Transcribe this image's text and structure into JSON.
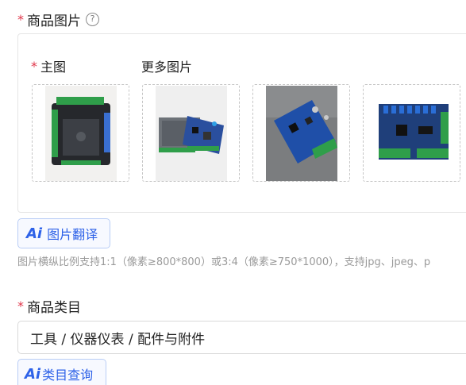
{
  "product_images": {
    "required_mark": "*",
    "label": "商品图片",
    "help_icon": "question-circle-icon",
    "main_image_label": "主图",
    "more_images_label": "更多图片",
    "thumbnails": [
      {
        "role": "main",
        "alt": "black-enclosed-control-board"
      },
      {
        "role": "more",
        "alt": "board-in-transparent-case"
      },
      {
        "role": "more",
        "alt": "blue-pcb-angled"
      },
      {
        "role": "more",
        "alt": "blue-pcb-top-view"
      }
    ]
  },
  "image_translate_button": {
    "ai_mark": "Ai",
    "label": "图片翻译"
  },
  "hint_text": "图片横纵比例支持1:1（像素≥800*800）或3:4（像素≥750*1000），支持jpg、jpeg、p",
  "product_category": {
    "required_mark": "*",
    "label": "商品类目",
    "value": "工具 / 仪器仪表 / 配件与附件"
  },
  "category_query_button": {
    "ai_mark": "Ai",
    "label": "类目查询"
  },
  "colors": {
    "required": "#e0364a",
    "ai_accent": "#2e62e8",
    "hint": "#9a9a9a"
  }
}
